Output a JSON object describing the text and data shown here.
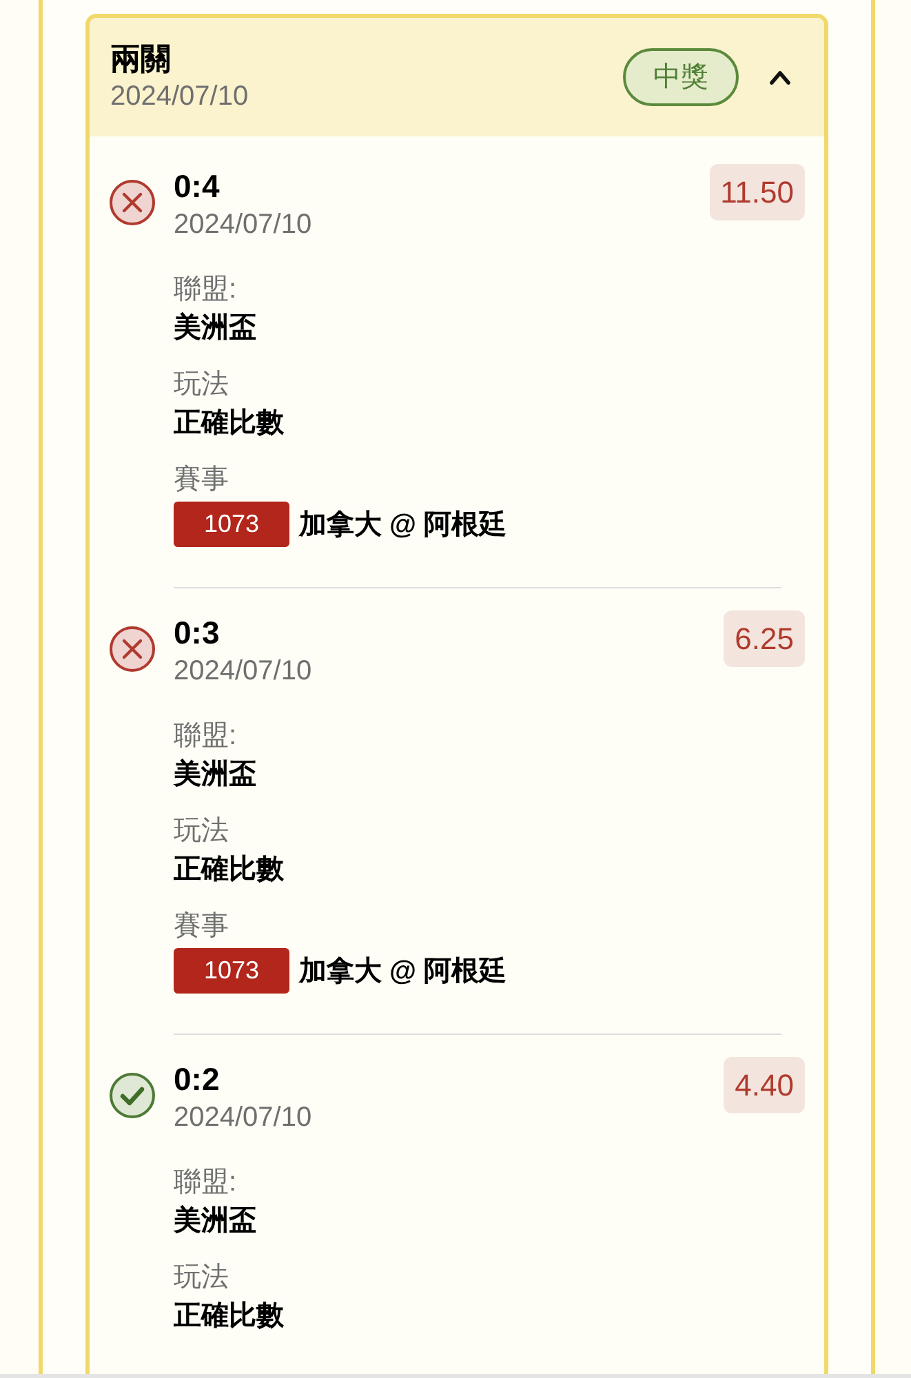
{
  "ticket": {
    "title": "兩關",
    "date": "2024/07/10",
    "status": {
      "label": "中獎",
      "kind": "won"
    },
    "expanded": true
  },
  "legs": [
    {
      "won": false,
      "pick": "0:4",
      "date": "2024/07/10",
      "odds": "11.50",
      "fields": [
        {
          "kind": "text",
          "label": "聯盟:",
          "value": "美洲盃"
        },
        {
          "kind": "text",
          "label": "玩法",
          "value": "正確比數"
        },
        {
          "kind": "match",
          "label": "賽事",
          "code": "1073",
          "value": "加拿大 @ 阿根廷"
        }
      ]
    },
    {
      "won": false,
      "pick": "0:3",
      "date": "2024/07/10",
      "odds": "6.25",
      "fields": [
        {
          "kind": "text",
          "label": "聯盟:",
          "value": "美洲盃"
        },
        {
          "kind": "text",
          "label": "玩法",
          "value": "正確比數"
        },
        {
          "kind": "match",
          "label": "賽事",
          "code": "1073",
          "value": "加拿大 @ 阿根廷"
        }
      ]
    },
    {
      "won": true,
      "pick": "0:2",
      "date": "2024/07/10",
      "odds": "4.40",
      "fields": [
        {
          "kind": "text",
          "label": "聯盟:",
          "value": "美洲盃"
        },
        {
          "kind": "text",
          "label": "玩法",
          "value": "正確比數"
        }
      ]
    }
  ]
}
